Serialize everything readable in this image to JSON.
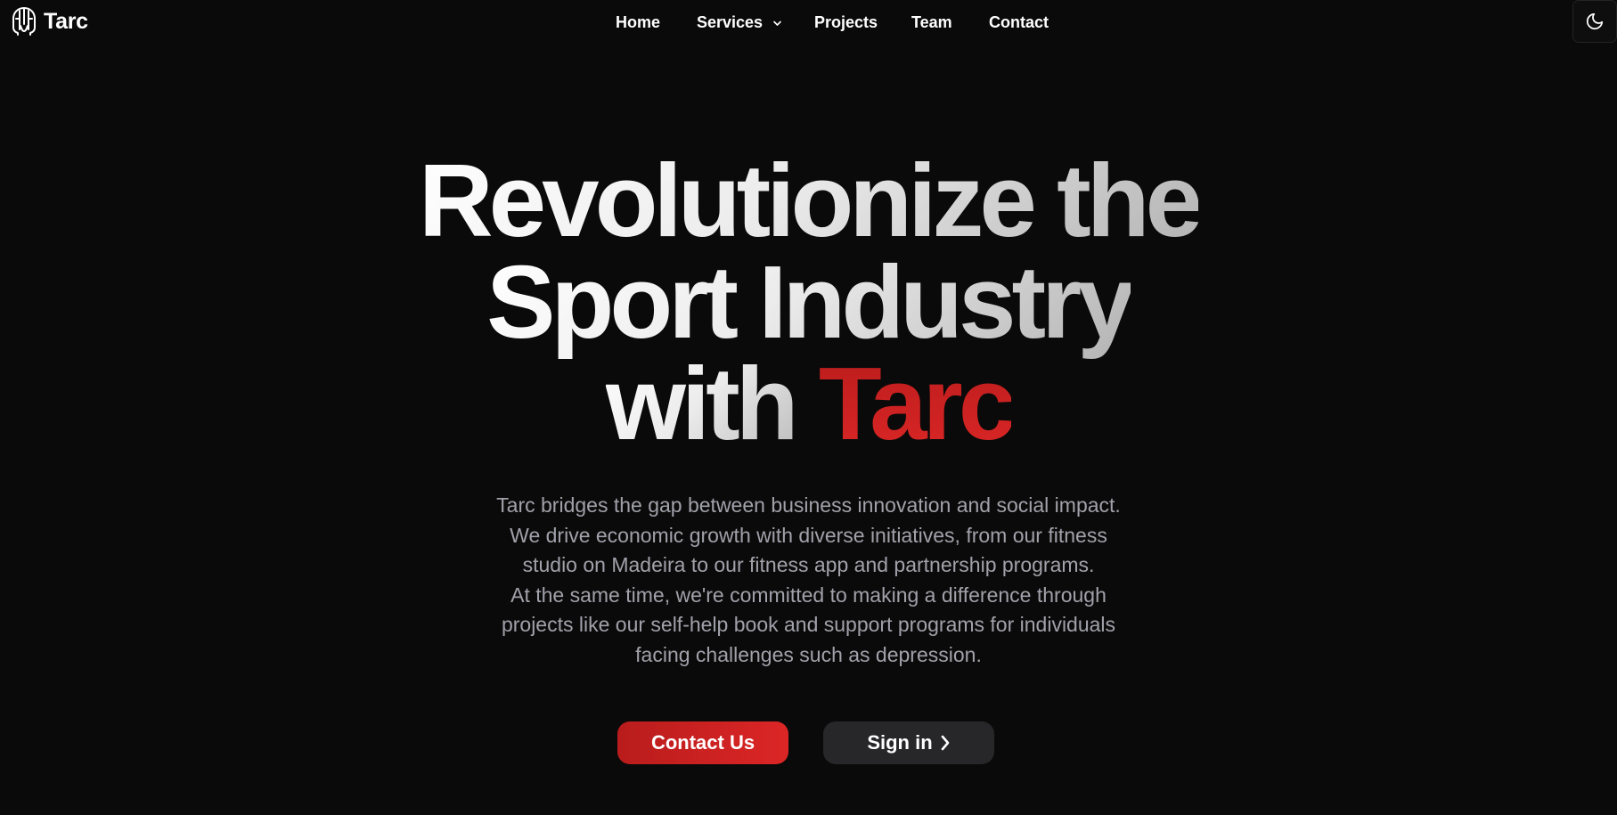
{
  "brand": {
    "name": "Tarc",
    "logo_icon": "spartan-helmet-icon"
  },
  "nav": {
    "items": [
      {
        "label": "Home"
      },
      {
        "label": "Services",
        "icon": "chevron-down-icon"
      },
      {
        "label": "Projects"
      },
      {
        "label": "Team"
      },
      {
        "label": "Contact"
      }
    ],
    "theme_toggle_icon": "moon-icon"
  },
  "hero": {
    "title_line1": "Revolutionize the",
    "title_line2": "Sport Industry",
    "title_line3_prefix": "with ",
    "title_accent": "Tarc",
    "description_lines": [
      "Tarc bridges the gap between business innovation and social impact.",
      "We drive economic growth with diverse initiatives, from our fitness",
      "studio on Madeira to our fitness app and partnership programs.",
      "At the same time, we're committed to making a difference through",
      "projects like our self-help book and support programs for individuals",
      "facing challenges such as depression."
    ]
  },
  "actions": {
    "primary_label": "Contact Us",
    "secondary_label": "Sign in",
    "secondary_icon": "chevron-right-icon"
  },
  "colors": {
    "background": "#0b0a0a",
    "accent": "#dc2626",
    "text_muted": "#a1a1aa",
    "secondary_button": "#27272a"
  }
}
